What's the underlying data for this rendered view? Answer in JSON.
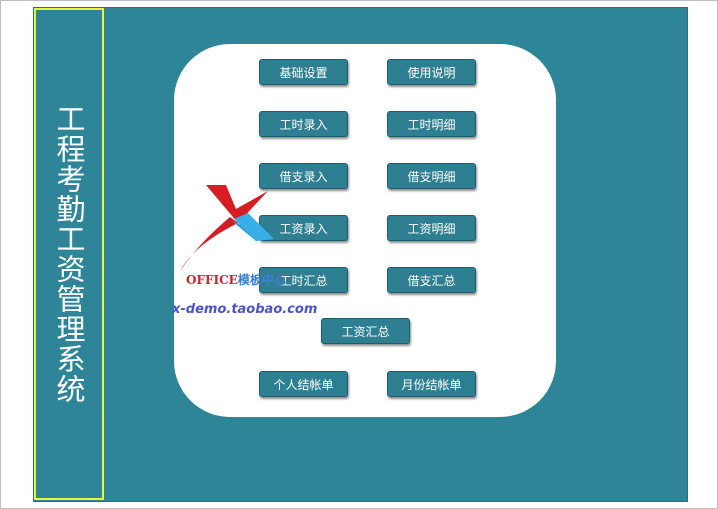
{
  "title": "工程考勤工资管理系统",
  "colors": {
    "panel": "#2f8598",
    "title_border": "#e6f53a",
    "button": "#2f7f92"
  },
  "buttons": [
    {
      "id": "basic-settings",
      "label": "基础设置"
    },
    {
      "id": "instructions",
      "label": "使用说明"
    },
    {
      "id": "hours-entry",
      "label": "工时录入"
    },
    {
      "id": "hours-detail",
      "label": "工时明细"
    },
    {
      "id": "loan-entry",
      "label": "借支录入"
    },
    {
      "id": "loan-detail",
      "label": "借支明细"
    },
    {
      "id": "wage-entry",
      "label": "工资录入"
    },
    {
      "id": "wage-detail",
      "label": "工资明细"
    },
    {
      "id": "hours-summary",
      "label": "工时汇总"
    },
    {
      "id": "loan-summary",
      "label": "借支汇总"
    },
    {
      "id": "wage-summary",
      "label": "工资汇总"
    },
    {
      "id": "personal-statement",
      "label": "个人结帐单"
    },
    {
      "id": "monthly-statement",
      "label": "月份结帐单"
    }
  ],
  "watermark": {
    "brand": "OFFICE",
    "brand_cn": "模板中心",
    "url": "x-demo.taobao.com"
  }
}
